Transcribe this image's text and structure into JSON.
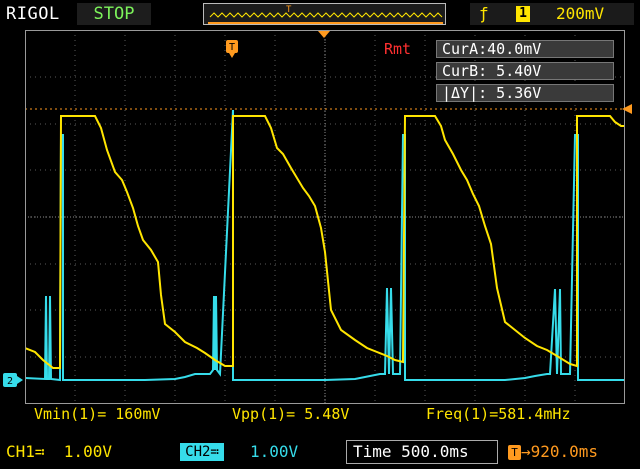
{
  "header": {
    "brand": "RIGOL",
    "run_state": "STOP",
    "trigger": {
      "edge_icon": "rising-edge-icon",
      "source": "1",
      "level": "200mV"
    }
  },
  "markers": {
    "trigger_pos": "T"
  },
  "cursors": {
    "mode": "Rmt",
    "cur_a": "CurA:40.0mV",
    "cur_b": "CurB: 5.40V",
    "delta": "|ΔY|: 5.36V"
  },
  "measurements": {
    "vmin": "Vmin(1)= 160mV",
    "vpp": "Vpp(1)= 5.48V",
    "freq": "Freq(1)=581.4mHz"
  },
  "footer": {
    "ch1": "CH1≕  1.00V",
    "ch2_badge": "CH2≕",
    "ch2_scale": "1.00V",
    "timebase": "Time 500.0ms",
    "trigger_offset": "→920.0ms"
  },
  "colors": {
    "ch1": "#ffe500",
    "ch2": "#36dcea",
    "trigger": "#ff9a1f",
    "cursor": "#ff3030"
  }
}
